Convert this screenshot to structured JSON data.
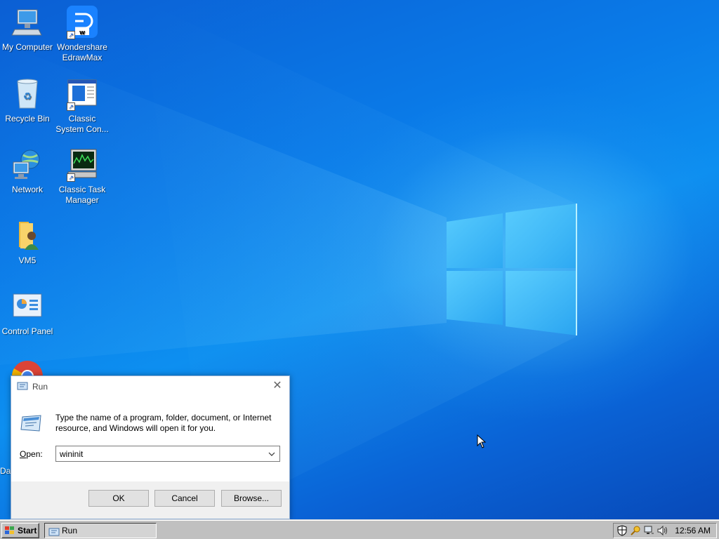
{
  "desktop": {
    "icons": [
      {
        "label": "My Computer",
        "icon": "computer-icon"
      },
      {
        "label": "Wondershare EdrawMax",
        "icon": "edrawmax-icon"
      },
      {
        "label": "Recycle Bin",
        "icon": "recycle-bin-icon"
      },
      {
        "label": "Classic System Con...",
        "icon": "system-config-icon"
      },
      {
        "label": "Network",
        "icon": "network-icon"
      },
      {
        "label": "Classic Task Manager",
        "icon": "task-manager-icon"
      },
      {
        "label": "VM5",
        "icon": "folder-user-icon"
      },
      {
        "label": "Control Panel",
        "icon": "control-panel-icon"
      },
      {
        "label": "",
        "icon": "chrome-icon"
      },
      {
        "label": "Da",
        "icon": ""
      }
    ]
  },
  "run_dialog": {
    "title": "Run",
    "description": "Type the name of a program, folder, document, or Internet resource, and Windows will open it for you.",
    "open_label_prefix": "",
    "open_label_accel": "O",
    "open_label_rest": "pen:",
    "open_value": "wininit",
    "ok_label": "OK",
    "cancel_label": "Cancel",
    "browse_label": "Browse..."
  },
  "taskbar": {
    "start_label": "Start",
    "tasks": [
      {
        "label": "Run",
        "active": true
      }
    ],
    "clock": "12:56 AM",
    "tray_icons": [
      "shield-icon",
      "key-search-icon",
      "network-tray-icon",
      "volume-icon"
    ]
  },
  "colors": {
    "wallpaper_primary": "#0a7be8",
    "taskbar": "#c0c0c0",
    "dialog_footer": "#f0f0f0"
  }
}
